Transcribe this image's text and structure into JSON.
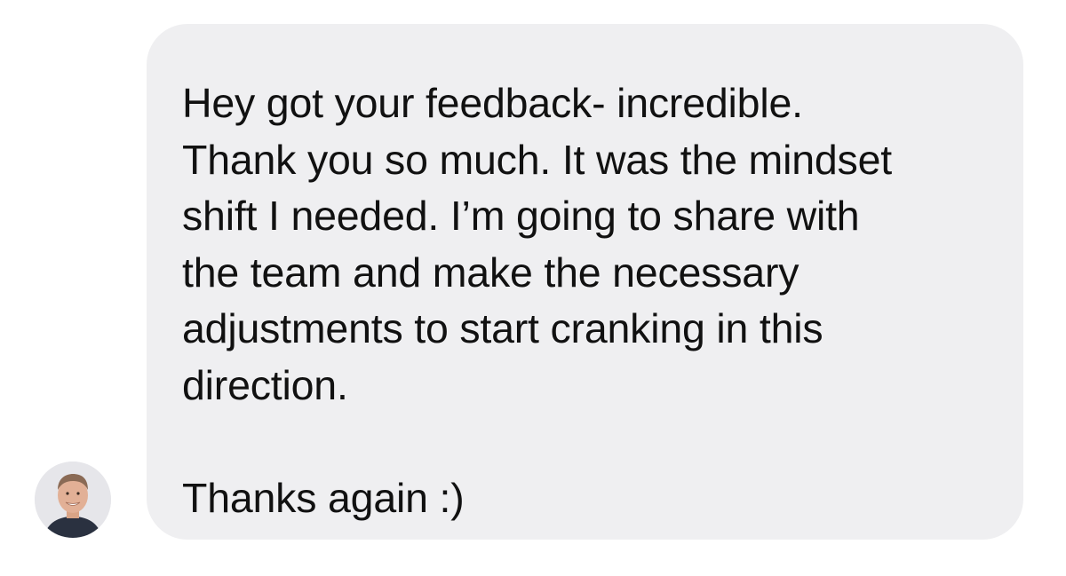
{
  "conversation": {
    "message": {
      "text": "Hey got your feedback- incredible.\nThank you so much. It was the mindset\nshift I needed. I’m going to share with\nthe team and make the necessary\nadjustments to start cranking in this\ndirection.\n\nThanks again :)",
      "bubble_color": "#efeff1",
      "text_color": "#111111"
    },
    "sender": {
      "avatar_icon": "user-avatar-icon"
    }
  }
}
